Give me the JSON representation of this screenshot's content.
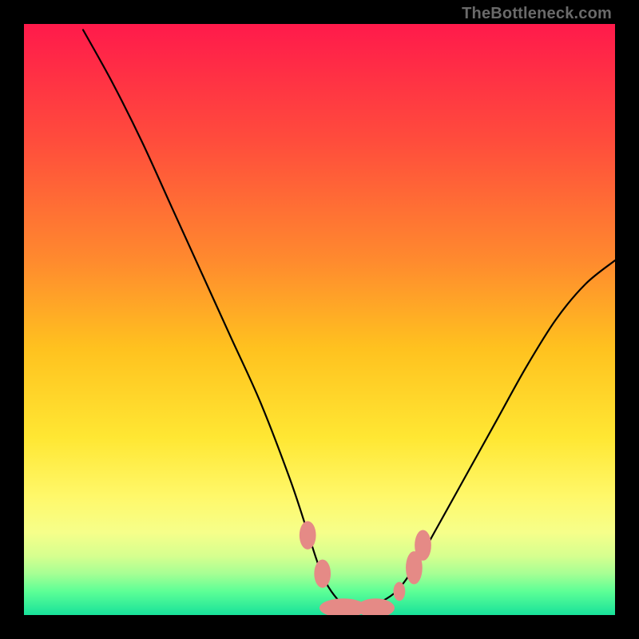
{
  "watermark": "TheBottleneck.com",
  "chart_data": {
    "type": "line",
    "title": "",
    "xlabel": "",
    "ylabel": "",
    "xlim": [
      0,
      100
    ],
    "ylim": [
      0,
      100
    ],
    "grid": false,
    "legend": false,
    "background_gradient": {
      "stops": [
        {
          "offset": 0.0,
          "color": "#ff1a4b"
        },
        {
          "offset": 0.2,
          "color": "#ff4d3c"
        },
        {
          "offset": 0.4,
          "color": "#ff8a2e"
        },
        {
          "offset": 0.55,
          "color": "#ffc21f"
        },
        {
          "offset": 0.7,
          "color": "#ffe733"
        },
        {
          "offset": 0.8,
          "color": "#fff86a"
        },
        {
          "offset": 0.86,
          "color": "#f6ff8a"
        },
        {
          "offset": 0.9,
          "color": "#d6ff8f"
        },
        {
          "offset": 0.93,
          "color": "#a6ff94"
        },
        {
          "offset": 0.96,
          "color": "#5dff96"
        },
        {
          "offset": 1.0,
          "color": "#18e29a"
        }
      ]
    },
    "series": [
      {
        "name": "bottleneck-curve",
        "x": [
          10,
          15,
          20,
          25,
          30,
          35,
          40,
          45,
          48,
          50,
          52,
          55,
          58,
          60,
          63,
          66,
          70,
          75,
          80,
          85,
          90,
          95,
          100
        ],
        "y": [
          99,
          90,
          80,
          69,
          58,
          47,
          36,
          23,
          14,
          8,
          4,
          1,
          1,
          2,
          4,
          8,
          15,
          24,
          33,
          42,
          50,
          56,
          60
        ]
      }
    ],
    "markers": {
      "color": "#e58a86",
      "points": [
        {
          "x": 48.0,
          "y": 13.5,
          "rx": 1.4,
          "ry": 2.4
        },
        {
          "x": 50.5,
          "y": 7.0,
          "rx": 1.4,
          "ry": 2.4
        },
        {
          "x": 54.0,
          "y": 1.2,
          "rx": 4.0,
          "ry": 1.6
        },
        {
          "x": 59.5,
          "y": 1.2,
          "rx": 3.2,
          "ry": 1.6
        },
        {
          "x": 63.5,
          "y": 4.0,
          "rx": 1.0,
          "ry": 1.6
        },
        {
          "x": 66.0,
          "y": 8.0,
          "rx": 1.4,
          "ry": 2.8
        },
        {
          "x": 67.5,
          "y": 11.8,
          "rx": 1.4,
          "ry": 2.6
        }
      ]
    }
  }
}
